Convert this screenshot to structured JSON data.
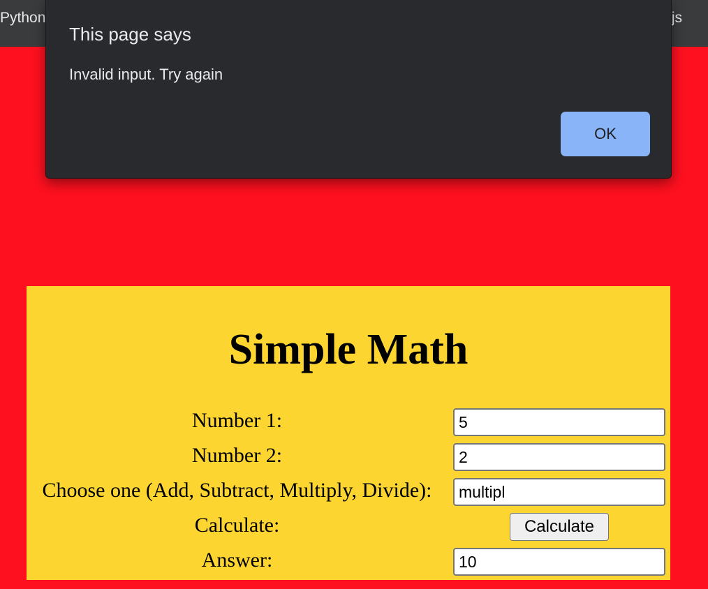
{
  "browser": {
    "tab_left_text": "Python",
    "tab_right_text": ".js"
  },
  "dialog": {
    "title": "This page says",
    "message": "Invalid input. Try again",
    "ok_label": "OK",
    "colors": {
      "background": "#292a2d",
      "button": "#8ab4f8",
      "text": "#e8eaed"
    }
  },
  "page": {
    "background_color": "#fe101f",
    "panel_color": "#fdd531",
    "title": "Simple Math",
    "form": {
      "number1_label": "Number 1:",
      "number1_value": "5",
      "number2_label": "Number 2:",
      "number2_value": "2",
      "operation_label": "Choose one (Add, Subtract, Multiply, Divide):",
      "operation_value": "multipl",
      "calculate_label": "Calculate:",
      "calculate_button": "Calculate",
      "answer_label": "Answer:",
      "answer_value": "10"
    }
  }
}
